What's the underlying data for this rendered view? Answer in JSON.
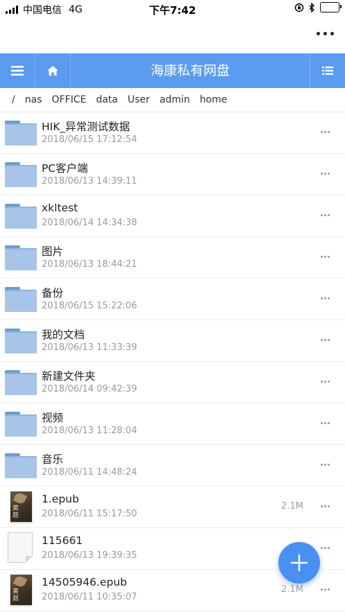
{
  "status_bar": {
    "carrier": "中国电信",
    "network": "4G",
    "time": "下午7:42"
  },
  "header": {
    "title": "海康私有网盘"
  },
  "breadcrumb": [
    "/",
    "nas",
    "OFFICE",
    "data",
    "User",
    "admin",
    "home"
  ],
  "files": [
    {
      "name": "HIK_异常测试数据",
      "date": "2018/06/15 17:12:54",
      "type": "folder",
      "size": ""
    },
    {
      "name": "PC客户端",
      "date": "2018/06/13 14:39:11",
      "type": "folder",
      "size": ""
    },
    {
      "name": "xkltest",
      "date": "2018/06/14 14:34:38",
      "type": "folder",
      "size": ""
    },
    {
      "name": "图片",
      "date": "2018/06/13 18:44:21",
      "type": "folder",
      "size": ""
    },
    {
      "name": "备份",
      "date": "2018/06/15 15:22:06",
      "type": "folder",
      "size": ""
    },
    {
      "name": "我的文档",
      "date": "2018/06/13 11:33:39",
      "type": "folder",
      "size": ""
    },
    {
      "name": "新建文件夹",
      "date": "2018/06/14 09:42:39",
      "type": "folder",
      "size": ""
    },
    {
      "name": "视频",
      "date": "2018/06/13 11:28:04",
      "type": "folder",
      "size": ""
    },
    {
      "name": "音乐",
      "date": "2018/06/11 14:48:24",
      "type": "folder",
      "size": ""
    },
    {
      "name": "1.epub",
      "date": "2018/06/11 15:17:50",
      "type": "epub",
      "size": "2.1M"
    },
    {
      "name": "115661",
      "date": "2018/06/13 19:39:35",
      "type": "file",
      "size": ""
    },
    {
      "name": "14505946.epub",
      "date": "2018/06/11 10:35:07",
      "type": "epub",
      "size": "2.1M"
    }
  ],
  "colors": {
    "header_bg": "#5b9bf0",
    "fab_bg": "#4a90f3",
    "folder": "#a6c5e8"
  },
  "icons": {
    "menu": "hamburger-icon",
    "home": "home-icon",
    "list": "list-icon",
    "fab": "plus-icon",
    "row_more": "ellipsis-icon"
  }
}
